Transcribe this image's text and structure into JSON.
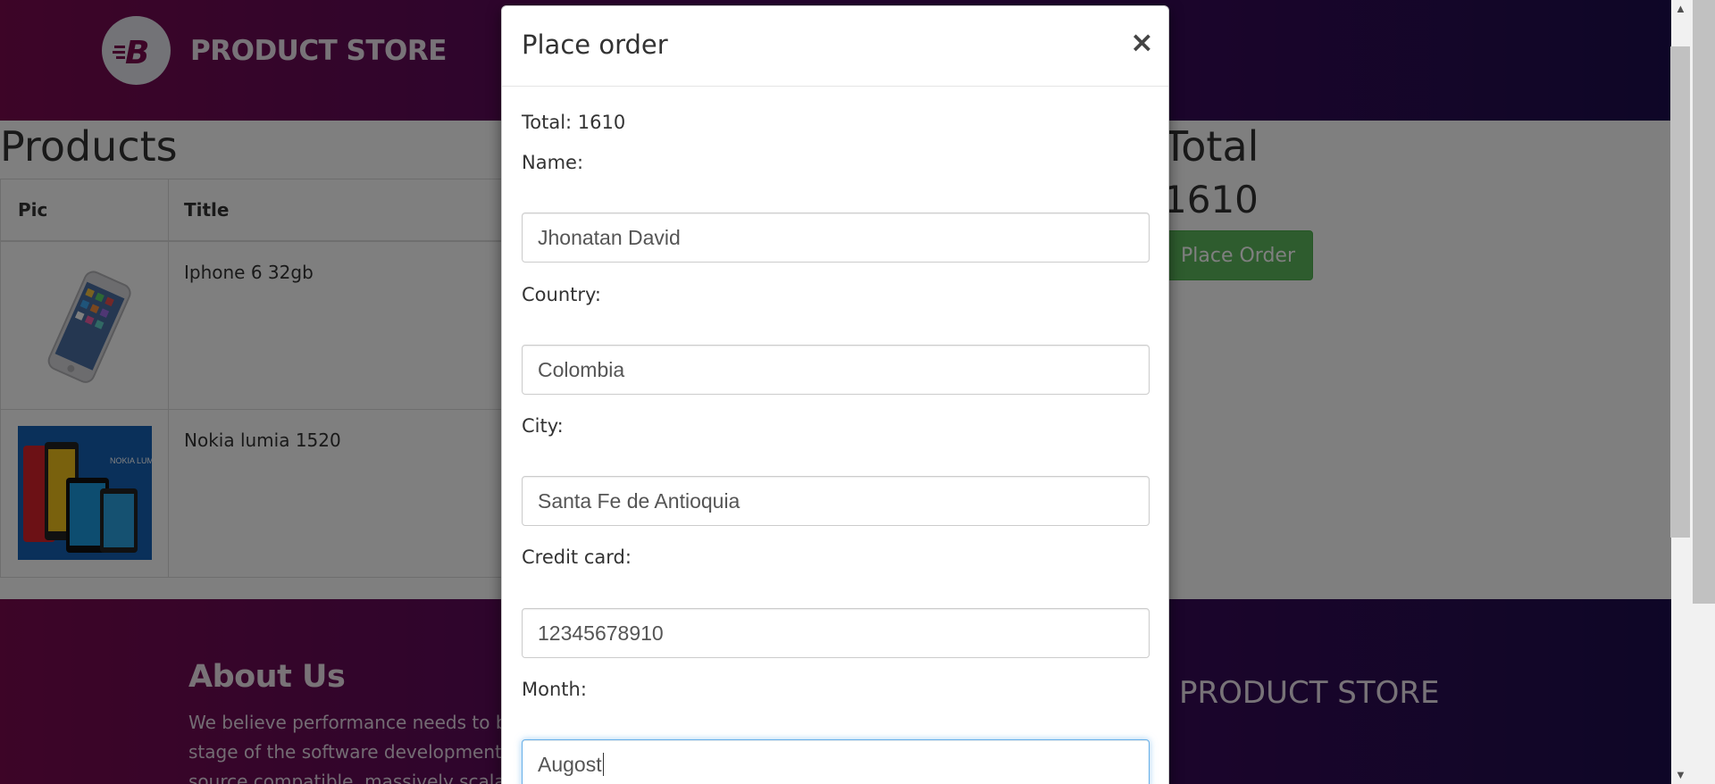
{
  "navbar": {
    "brand_name": "PRODUCT STORE"
  },
  "cart": {
    "title": "Products",
    "headers": [
      "Pic",
      "Title"
    ],
    "rows": [
      {
        "title": "Iphone 6 32gb",
        "image": "iphone-image"
      },
      {
        "title": "Nokia lumia 1520",
        "image": "nokia-image"
      }
    ],
    "nokia_image_text": "NOKIA LUMIA",
    "total_label": "Total",
    "total_value": "1610",
    "place_order_label": "Place Order"
  },
  "footer": {
    "about_title": "About Us",
    "about_lines": [
      "We believe performance needs to be",
      "stage of the software development c",
      "source compatible, massively scalabl"
    ],
    "brand_name": "PRODUCT STORE"
  },
  "modal": {
    "title": "Place order",
    "close": "×",
    "total_text": "Total: 1610",
    "fields": [
      {
        "label": "Name:",
        "value": "Jhonatan David"
      },
      {
        "label": "Country:",
        "value": "Colombia"
      },
      {
        "label": "City:",
        "value": "Santa Fe de Antioquia"
      },
      {
        "label": "Credit card:",
        "value": "12345678910"
      },
      {
        "label": "Month:",
        "value": "Augost"
      }
    ]
  },
  "colors": {
    "header_start": "#7a0a4f",
    "header_end": "#1d0c4e",
    "success": "#5cb85c",
    "focus": "#66afe9"
  }
}
